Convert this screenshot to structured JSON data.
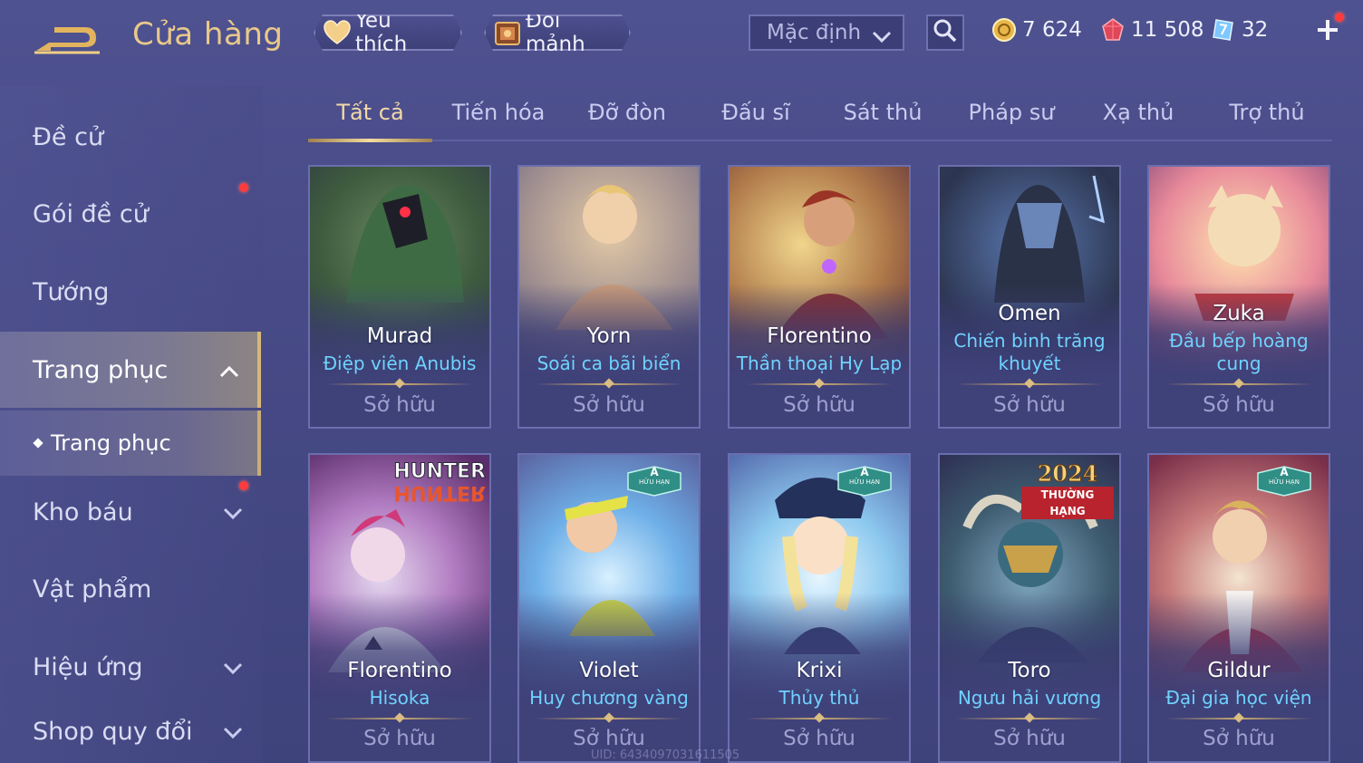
{
  "header": {
    "title": "Cửa hàng",
    "favorite_label": "Yêu thích",
    "exchange_label": "Đổi mảnh",
    "sort_value": "Mặc định",
    "currencies": [
      {
        "name": "gold",
        "value": "7 624",
        "color": "#e8b64a"
      },
      {
        "name": "ruby",
        "value": "11 508",
        "color": "#e0475a"
      },
      {
        "name": "coupon",
        "value": "32",
        "color": "#7ec8ff"
      }
    ]
  },
  "sidebar": {
    "items": [
      {
        "label": "Đề cử"
      },
      {
        "label": "Gói đề cử"
      },
      {
        "label": "Tướng"
      },
      {
        "label": "Trang phục"
      },
      {
        "label": "Kho báu"
      },
      {
        "label": "Vật phẩm"
      },
      {
        "label": "Hiệu ứng"
      },
      {
        "label": "Shop quy đổi"
      }
    ],
    "sub_item": "Trang phục"
  },
  "tabs": [
    "Tất cả",
    "Tiến hóa",
    "Đỡ đòn",
    "Đấu sĩ",
    "Sát thủ",
    "Pháp sư",
    "Xạ thủ",
    "Trợ thủ"
  ],
  "cards": [
    {
      "hero": "Murad",
      "skin": "Điệp viên Anubis",
      "status": "Sở hữu"
    },
    {
      "hero": "Yorn",
      "skin": "Soái ca bãi biển",
      "status": "Sở hữu"
    },
    {
      "hero": "Florentino",
      "skin": "Thần thoại Hy Lạp",
      "status": "Sở hữu"
    },
    {
      "hero": "Omen",
      "skin": "Chiến binh trăng khuyết",
      "status": "Sở hữu"
    },
    {
      "hero": "Zuka",
      "skin": "Đầu bếp hoàng cung",
      "status": "Sở hữu"
    },
    {
      "hero": "Florentino",
      "skin": "Hisoka",
      "status": "Sở hữu",
      "logo_top": "HUNTER",
      "logo_bottom": "HUNTER"
    },
    {
      "hero": "Violet",
      "skin": "Huy chương vàng",
      "status": "Sở hữu",
      "badge_letter": "A",
      "badge_text": "HỮU HẠN"
    },
    {
      "hero": "Krixi",
      "skin": "Thủy thủ",
      "status": "Sở hữu",
      "badge_letter": "A",
      "badge_text": "HỮU HẠN"
    },
    {
      "hero": "Toro",
      "skin": "Ngưu hải vương",
      "status": "Sở hữu",
      "rank_year": "2024",
      "rank_text": "THƯỜNG HẠNG"
    },
    {
      "hero": "Gildur",
      "skin": "Đại gia học viện",
      "status": "Sở hữu",
      "badge_letter": "A",
      "badge_text": "HỮU HẠN"
    }
  ],
  "uid": "UID: 6434097031611505"
}
